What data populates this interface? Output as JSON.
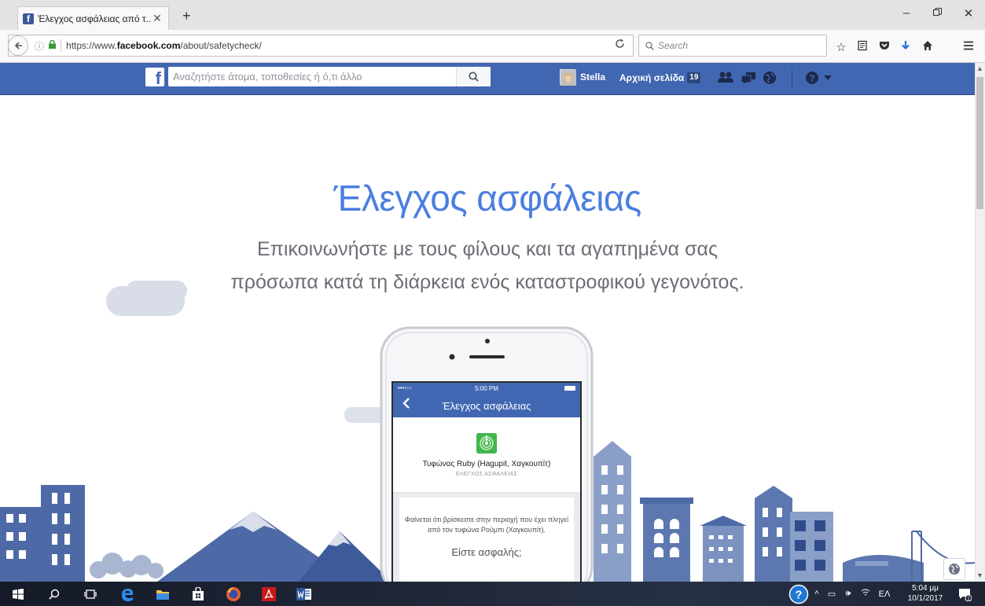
{
  "browser": {
    "tab_title": "Έλεγχος ασφάλειας από τ...",
    "tab_favicon_letter": "f",
    "url_prefix": "https://www.",
    "url_domain": "facebook.com",
    "url_path": "/about/safetycheck/",
    "search_placeholder": "Search",
    "icons": [
      "back-icon",
      "info-icon",
      "lock-icon",
      "reload-icon",
      "search-icon",
      "bookmark-star-icon",
      "reading-list-icon",
      "pocket-icon",
      "download-icon",
      "home-icon",
      "menu-icon"
    ]
  },
  "facebook_bar": {
    "logo": "f",
    "search_placeholder": "Αναζητήστε άτομα, τοποθεσίες ή ό,τι άλλο",
    "user_name": "Stella",
    "home_label": "Αρχική σελίδα",
    "home_count": "19",
    "colors": {
      "bar": "#4267b2",
      "border": "#29487d"
    }
  },
  "hero": {
    "title": "Έλεγχος ασφάλειας",
    "subtitle_line1": "Επικοινωνήστε με τους φίλους και τα αγαπημένα σας",
    "subtitle_line2": "πρόσωπα κατά τη διάρκεια ενός καταστροφικού γεγονότος.",
    "title_color": "#4b7ee0"
  },
  "phone": {
    "status_time": "5:00 PM",
    "status_dots": "•••○○",
    "header_title": "Έλεγχος ασφάλειας",
    "event_name": "Τυφώνας Ruby (Hagupit, Χαγκουπίτ)",
    "event_category": "ΕΛΕΓΧΟΣ ΑΣΦΑΛΕΙΑΣ",
    "description": "Φαίνεται ότι βρίσκεστε στην περιοχή που έχει πληγεί από τον τυφώνα Ρούμπι (Χαγκουπίτ).",
    "question": "Είστε ασφαλής;"
  },
  "taskbar": {
    "tray_language": "ΕΛ",
    "clock_time": "5:04 μμ",
    "clock_date": "10/1/2017",
    "notification_count": "1"
  }
}
